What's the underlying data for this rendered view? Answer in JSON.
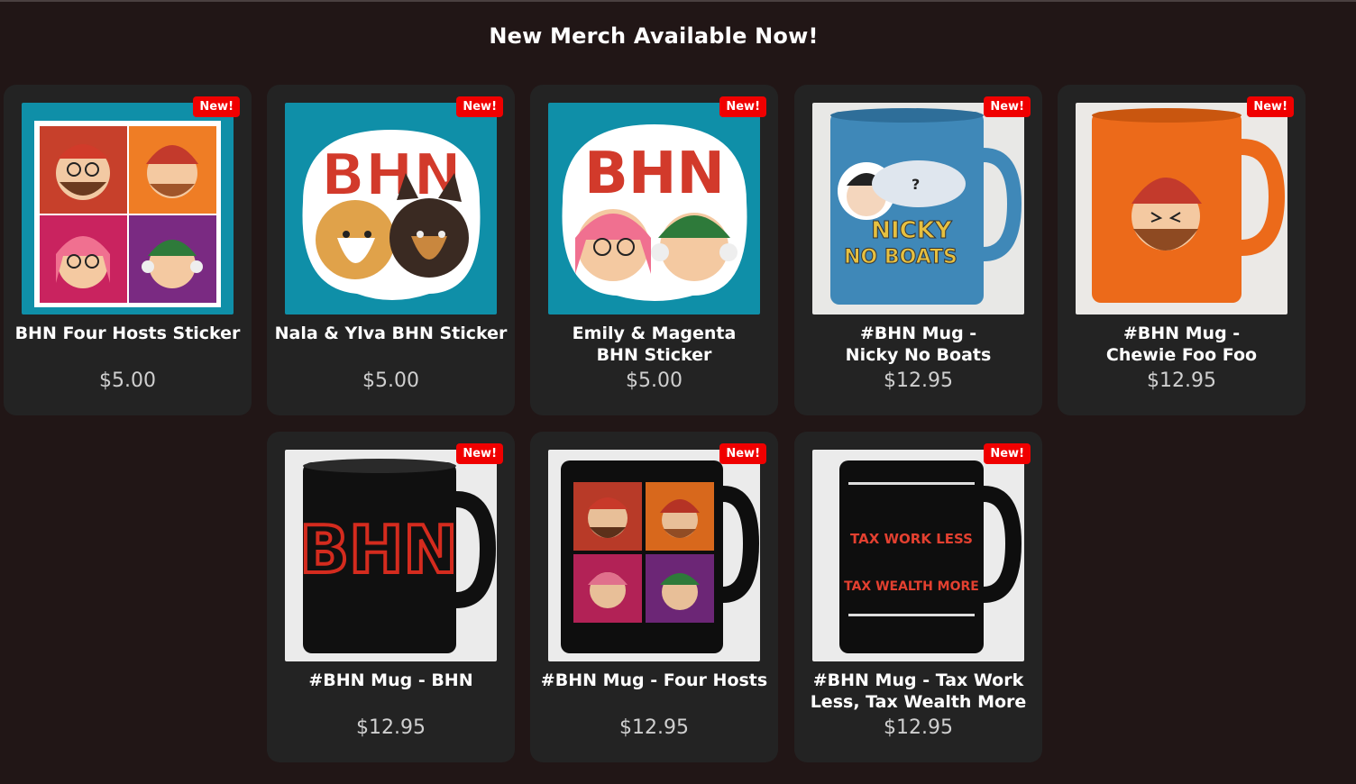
{
  "header": {
    "title": "New Merch Available Now!"
  },
  "badge_label": "New!",
  "products": [
    {
      "name": "BHN Four Hosts Sticker",
      "price": "$5.00",
      "image": "four-hosts-sticker"
    },
    {
      "name": "Nala & Ylva BHN Sticker",
      "price": "$5.00",
      "image": "dogs-sticker"
    },
    {
      "name_lines": [
        "Emily & Magenta",
        "BHN Sticker"
      ],
      "price": "$5.00",
      "image": "emily-magenta-sticker"
    },
    {
      "name_lines": [
        "#BHN Mug -",
        "Nicky No Boats"
      ],
      "price": "$12.95",
      "image": "blue-mug",
      "mug_text": [
        "NICKY",
        "NO BOATS"
      ]
    },
    {
      "name_lines": [
        "#BHN Mug -",
        "Chewie Foo Foo"
      ],
      "price": "$12.95",
      "image": "orange-mug"
    },
    {
      "name": "#BHN Mug - BHN",
      "price": "$12.95",
      "image": "black-mug-bhn",
      "mug_text": [
        "BHN"
      ]
    },
    {
      "name": "#BHN Mug - Four Hosts",
      "price": "$12.95",
      "image": "black-mug-four-hosts"
    },
    {
      "name_lines": [
        "#BHN Mug - Tax Work",
        "Less, Tax Wealth More"
      ],
      "price": "$12.95",
      "image": "black-mug-tax",
      "mug_text": [
        "TAX WORK LESS",
        "TAX WEALTH MORE"
      ]
    }
  ],
  "sticker_text": "BHN",
  "colors": {
    "background": "#211616",
    "card": "#232323",
    "badge": "#f00000",
    "teal": "#0f8fa8"
  }
}
